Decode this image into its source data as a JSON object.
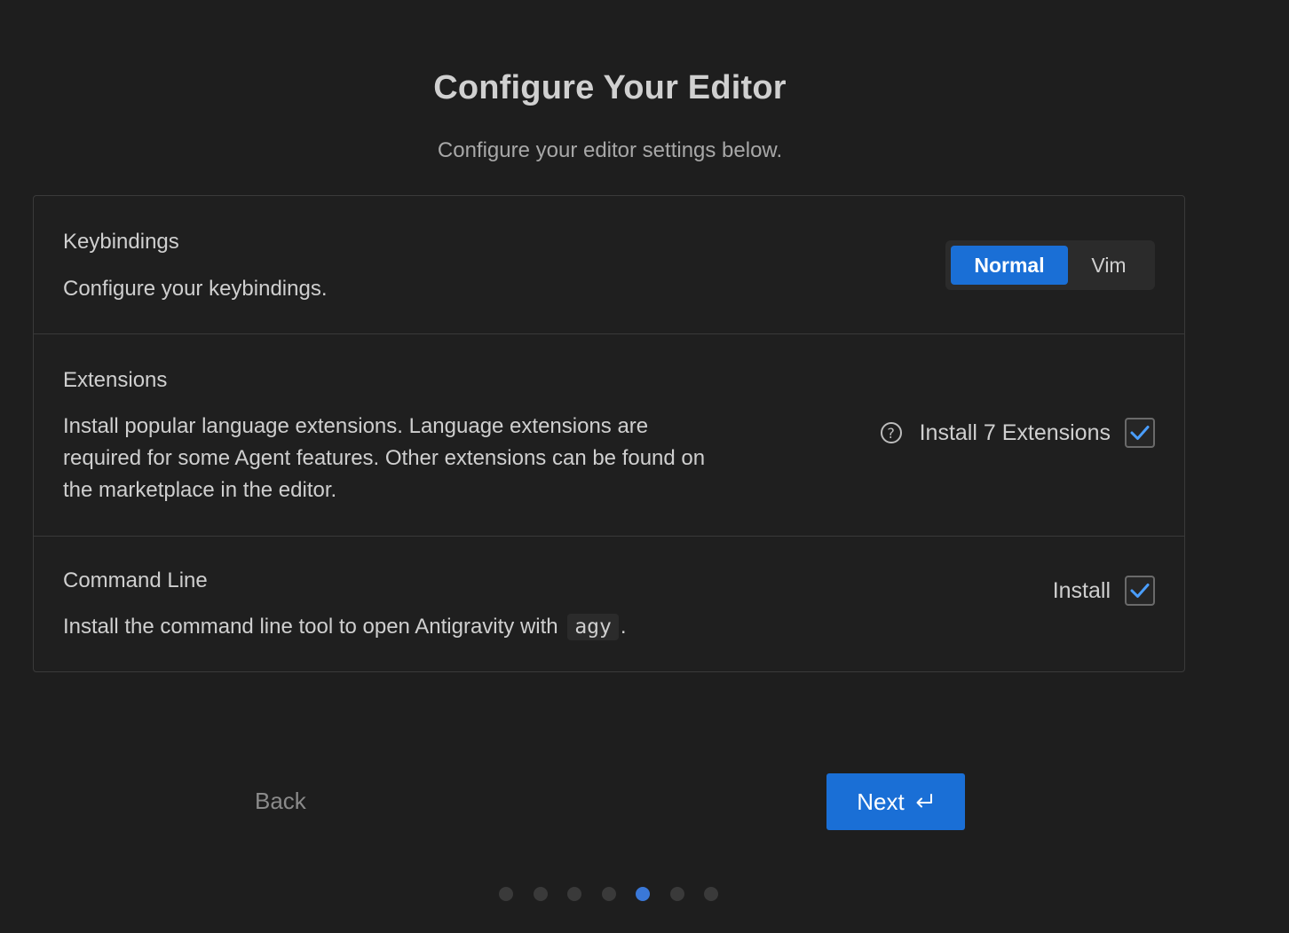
{
  "header": {
    "title": "Configure Your Editor",
    "subtitle": "Configure your editor settings below."
  },
  "keybindings": {
    "title": "Keybindings",
    "description": "Configure your keybindings.",
    "options": [
      "Normal",
      "Vim"
    ],
    "selected": "Normal"
  },
  "extensions": {
    "title": "Extensions",
    "description": "Install popular language extensions. Language extensions are required for some Agent features. Other extensions can be found on the marketplace in the editor.",
    "checkbox_label": "Install 7 Extensions",
    "checked": true,
    "help_icon": "question-circle-icon"
  },
  "command_line": {
    "title": "Command Line",
    "description_prefix": "Install the command line tool to open Antigravity with",
    "command": "agy",
    "description_suffix": ".",
    "checkbox_label": "Install",
    "checked": true
  },
  "footer": {
    "back_label": "Back",
    "next_label": "Next",
    "next_icon": "enter-return-icon",
    "steps_total": 7,
    "current_step": 5
  },
  "colors": {
    "background": "#1e1e1e",
    "accent": "#1a6fd6",
    "checkmark": "#4a9eff",
    "active_dot": "#3a78d8"
  }
}
